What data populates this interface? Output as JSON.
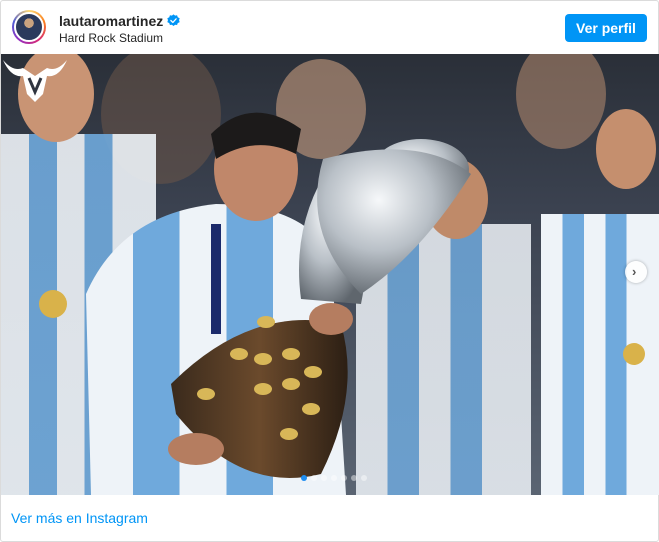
{
  "header": {
    "username": "lautaromartinez",
    "verified": true,
    "location": "Hard Rock Stadium",
    "follow_button": "Ver perfil"
  },
  "media": {
    "carousel_total": 7,
    "carousel_active_index": 0,
    "next_icon": "chevron-right-icon",
    "brand_logo": "bull-logo"
  },
  "footer": {
    "link_label": "Ver más en Instagram"
  },
  "colors": {
    "accent": "#0095f6",
    "text": "#262626",
    "border": "#dbdbdb"
  }
}
